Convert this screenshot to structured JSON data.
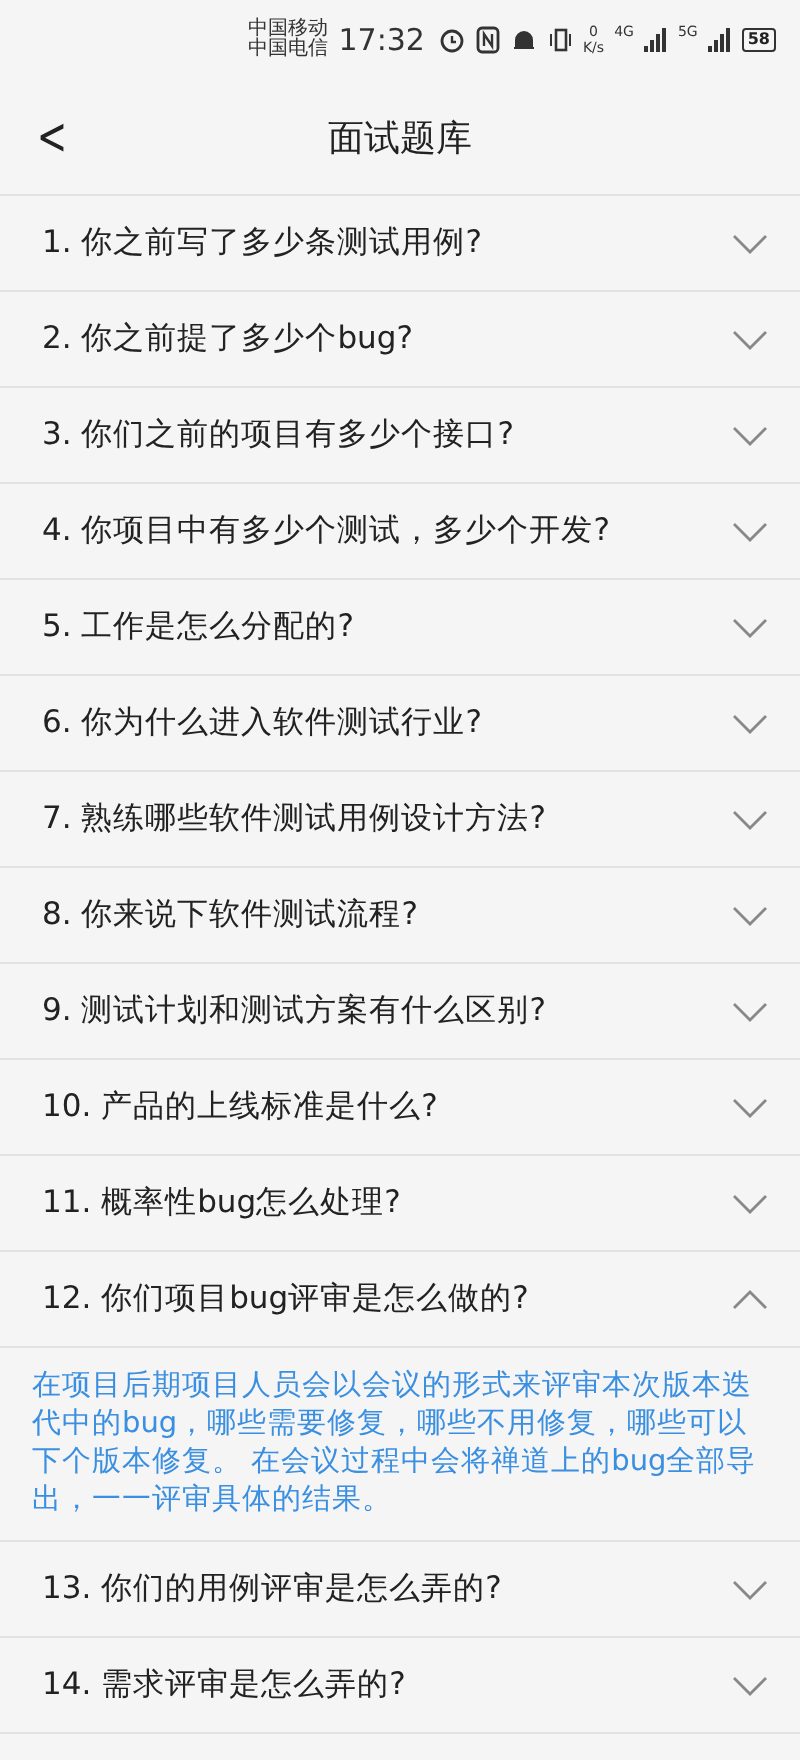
{
  "status_bar": {
    "carriers": [
      "中国移动",
      "中国电信"
    ],
    "time": "17:32",
    "speed": "0",
    "speed_unit": "K/s",
    "network_1": "4G",
    "network_2": "5G",
    "battery": "58"
  },
  "header": {
    "back": "<",
    "title": "面试题库"
  },
  "questions": [
    {
      "title": "1. 你之前写了多少条测试用例?",
      "expanded": false
    },
    {
      "title": "2. 你之前提了多少个bug?",
      "expanded": false
    },
    {
      "title": "3. 你们之前的项目有多少个接口?",
      "expanded": false
    },
    {
      "title": "4. 你项目中有多少个测试，多少个开发?",
      "expanded": false
    },
    {
      "title": "5. 工作是怎么分配的?",
      "expanded": false
    },
    {
      "title": "6. 你为什么进入软件测试行业?",
      "expanded": false
    },
    {
      "title": "7. 熟练哪些软件测试用例设计方法?",
      "expanded": false
    },
    {
      "title": "8. 你来说下软件测试流程?",
      "expanded": false
    },
    {
      "title": "9. 测试计划和测试方案有什么区别?",
      "expanded": false
    },
    {
      "title": "10. 产品的上线标准是什么?",
      "expanded": false
    },
    {
      "title": "11. 概率性bug怎么处理?",
      "expanded": false
    },
    {
      "title": "12. 你们项目bug评审是怎么做的?",
      "expanded": true,
      "answer": "在项目后期项目人员会以会议的形式来评审本次版本迭代中的bug，哪些需要修复，哪些不用修复，哪些可以下个版本修复。 在会议过程中会将禅道上的bug全部导出，一一评审具体的结果。"
    },
    {
      "title": "13. 你们的用例评审是怎么弄的?",
      "expanded": false
    },
    {
      "title": "14. 需求评审是怎么弄的?",
      "expanded": false
    }
  ]
}
